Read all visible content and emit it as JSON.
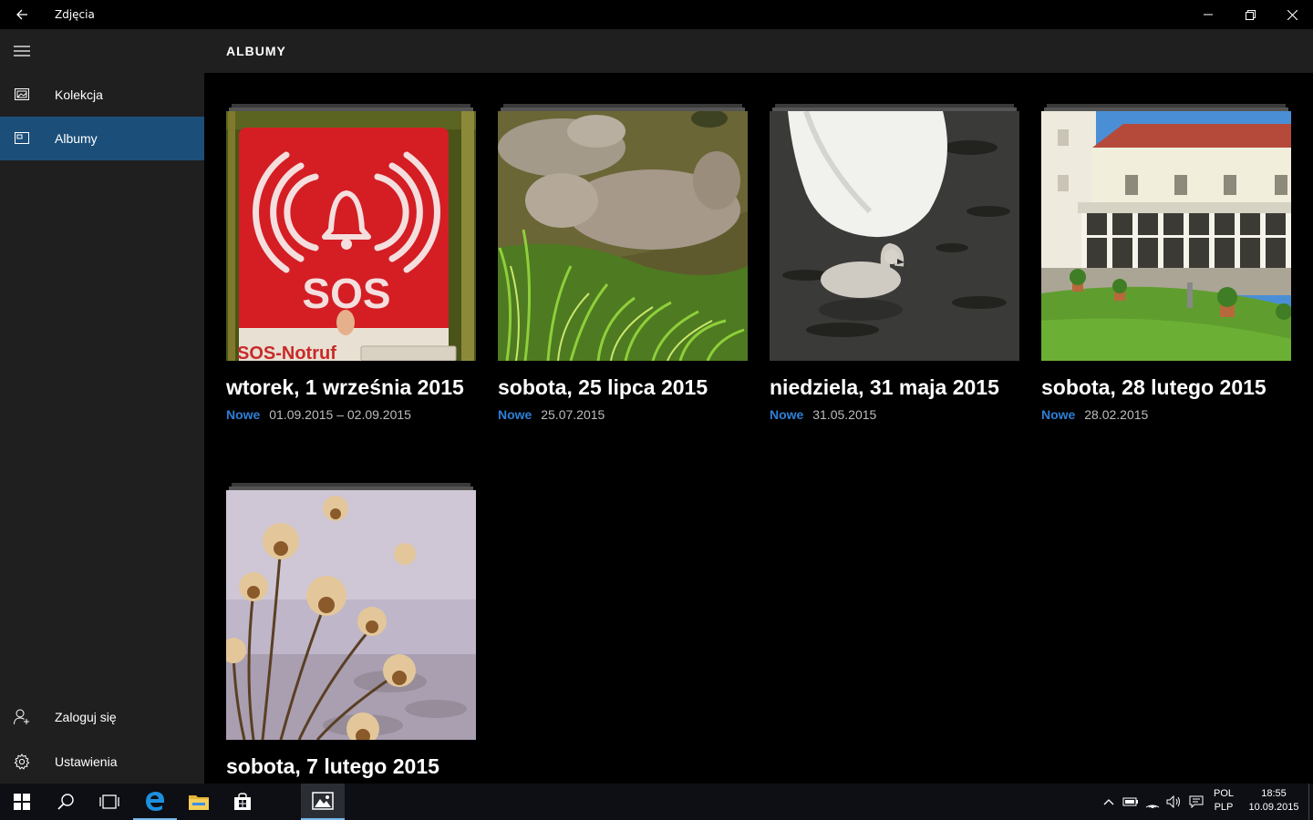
{
  "window": {
    "title": "Zdjęcia"
  },
  "header": {
    "title": "ALBUMY"
  },
  "sidebar": {
    "items": [
      {
        "label": "Kolekcja",
        "icon": "collection-icon"
      },
      {
        "label": "Albumy",
        "icon": "album-icon",
        "selected": true
      }
    ],
    "footer": [
      {
        "label": "Zaloguj się",
        "icon": "add-user-icon"
      },
      {
        "label": "Ustawienia",
        "icon": "gear-icon"
      }
    ]
  },
  "albums": [
    {
      "title": "wtorek, 1 września 2015",
      "badge": "Nowe",
      "date": "01.09.2015 – 02.09.2015"
    },
    {
      "title": "sobota, 25 lipca 2015",
      "badge": "Nowe",
      "date": "25.07.2015"
    },
    {
      "title": "niedziela, 31 maja 2015",
      "badge": "Nowe",
      "date": "31.05.2015"
    },
    {
      "title": "sobota, 28 lutego 2015",
      "badge": "Nowe",
      "date": "28.02.2015"
    },
    {
      "title": "sobota, 7 lutego 2015"
    }
  ],
  "photo_text": {
    "sos": "SOS",
    "notruf": "SOS-Notruf"
  },
  "taskbar": {
    "lang_top": "POL",
    "lang_bottom": "PLP",
    "time": "18:55",
    "date": "10.09.2015"
  },
  "colors": {
    "accent": "#1b4f7a",
    "new_badge": "#2e7fd7",
    "sidebar_bg": "#1f1f1f"
  }
}
